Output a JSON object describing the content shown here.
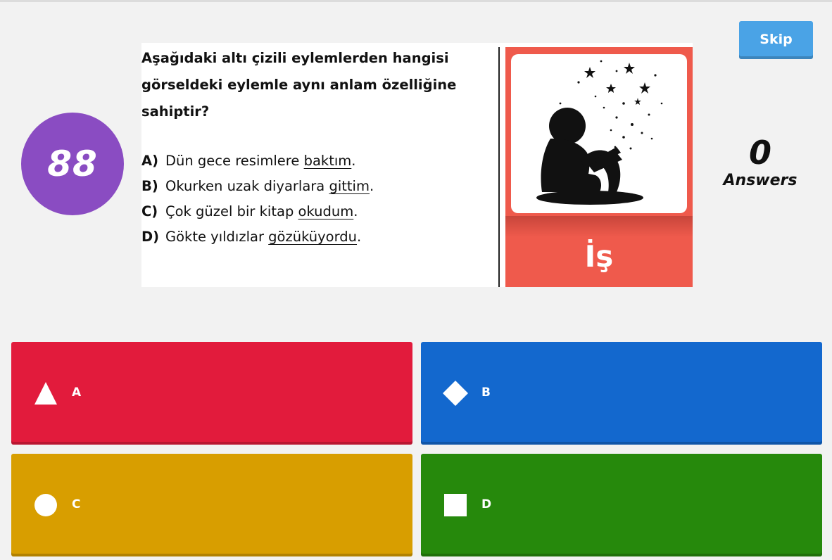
{
  "skip_label": "Skip",
  "timer_value": "88",
  "answers_count": "0",
  "answers_label": "Answers",
  "question": {
    "text": "Aşağıdaki altı çizili eylemlerden hangisi görseldeki eylemle aynı anlam özelliğine sahiptir?",
    "options": [
      {
        "letter": "A)",
        "before": "Dün gece resimlere ",
        "underlined": "baktım",
        "after": "."
      },
      {
        "letter": "B)",
        "before": "Okurken uzak diyarlara ",
        "underlined": "gittim",
        "after": "."
      },
      {
        "letter": "C)",
        "before": "Çok güzel bir kitap ",
        "underlined": "okudum",
        "after": "."
      },
      {
        "letter": "D)",
        "before": "Gökte yıldızlar ",
        "underlined": "gözüküyordu",
        "after": "."
      }
    ],
    "card_label": "İş"
  },
  "answer_buttons": [
    {
      "label": "A",
      "icon": "triangle-icon",
      "color": "#e21b3c"
    },
    {
      "label": "B",
      "icon": "diamond-icon",
      "color": "#1368ce"
    },
    {
      "label": "C",
      "icon": "circle-icon",
      "color": "#d89e00"
    },
    {
      "label": "D",
      "icon": "square-icon",
      "color": "#26890c"
    }
  ],
  "colors": {
    "timer": "#8a4cc2",
    "skip": "#4aa3e6",
    "card": "#ef5a4c"
  }
}
